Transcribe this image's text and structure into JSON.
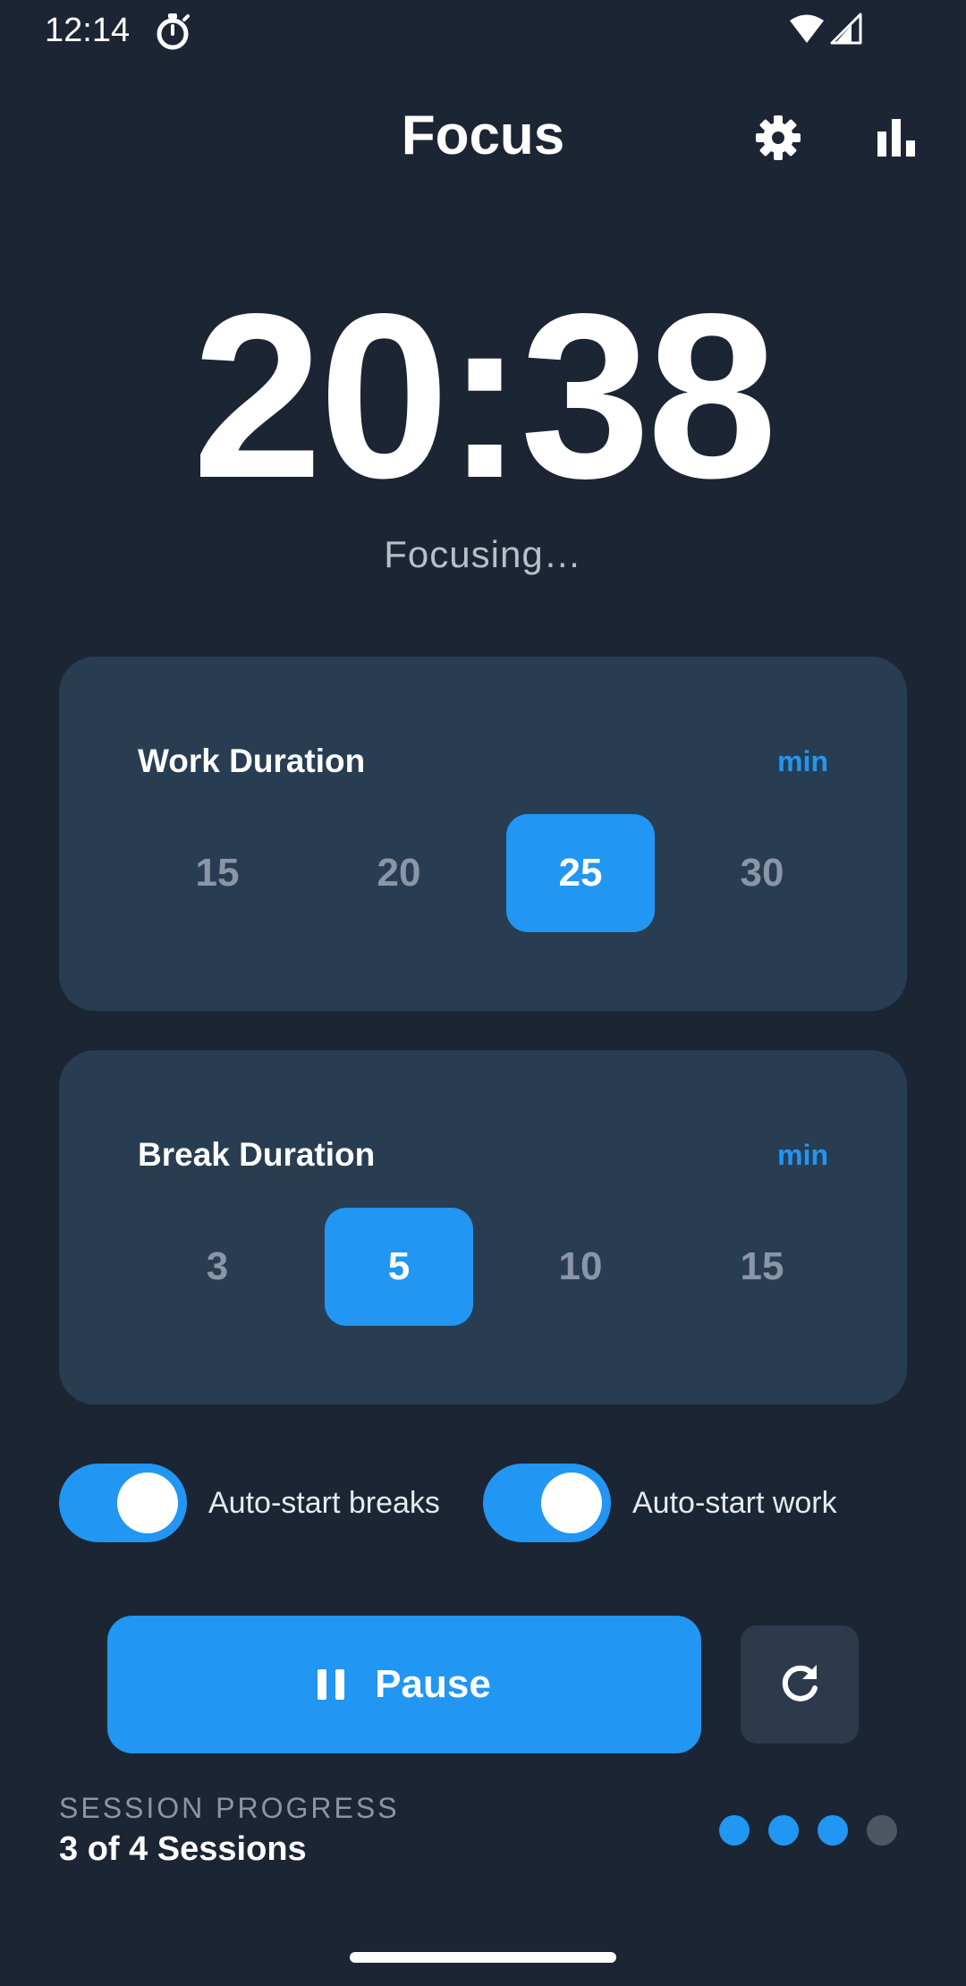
{
  "status_bar": {
    "time": "12:14",
    "app_icon": "timer-icon",
    "wifi_icon": "wifi-icon",
    "signal_icon": "cell-signal-icon"
  },
  "header": {
    "title": "Focus",
    "settings_icon": "gear-icon",
    "stats_icon": "bar-chart-icon"
  },
  "timer": {
    "display": "20:38",
    "status": "Focusing…"
  },
  "work_duration": {
    "title": "Work Duration",
    "unit": "min",
    "options": [
      "15",
      "20",
      "25",
      "30"
    ],
    "selected": "25"
  },
  "break_duration": {
    "title": "Break Duration",
    "unit": "min",
    "options": [
      "3",
      "5",
      "10",
      "15"
    ],
    "selected": "5"
  },
  "toggles": {
    "auto_start_breaks": {
      "label": "Auto-start breaks",
      "on": true
    },
    "auto_start_work": {
      "label": "Auto-start work",
      "on": true
    }
  },
  "actions": {
    "pause_label": "Pause",
    "pause_icon": "pause-icon",
    "reset_icon": "refresh-icon"
  },
  "session_progress": {
    "caption": "SESSION PROGRESS",
    "count_text": "3 of 4 Sessions",
    "completed": 3,
    "total": 4
  },
  "colors": {
    "background": "#1c2533",
    "card": "#283d52",
    "accent": "#2196f3",
    "muted_text": "#8a96a6",
    "dot_inactive": "#4d5763"
  }
}
